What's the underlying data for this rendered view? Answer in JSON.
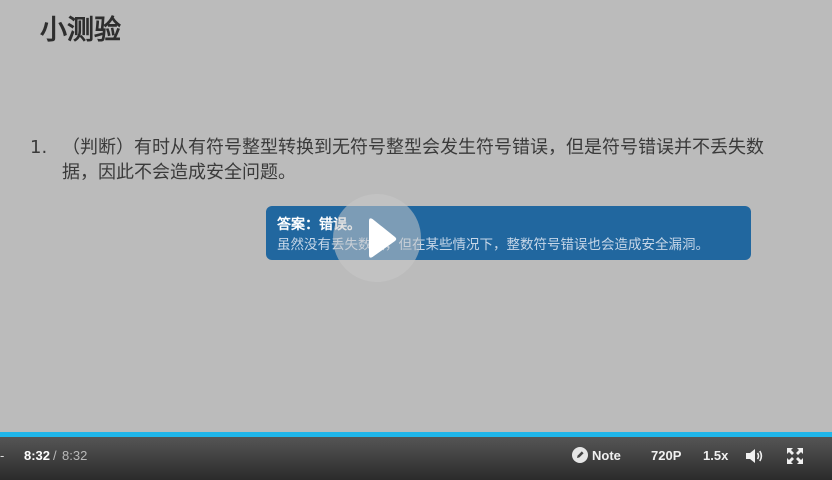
{
  "slide": {
    "title": "小测验",
    "question_number": "1.",
    "question_text": "（判断）有时从有符号整型转换到无符号整型会发生符号错误，但是符号错误并不丢失数据，因此不会造成安全问题。",
    "answer_title": "答案：错误。",
    "answer_body": "虽然没有丢失数据，但在某些情况下，整数符号错误也会造成安全漏洞。"
  },
  "player": {
    "progress_percent": 100,
    "accent_color": "#1fb6ea",
    "play_icon": "play-icon",
    "time_current": "8:32",
    "time_separator": "/",
    "time_total": "8:32",
    "note_label": "Note",
    "quality_label": "720P",
    "speed_label": "1.5x",
    "volume_icon": "volume-icon",
    "fullscreen_icon": "fullscreen-icon",
    "note_icon": "pencil-icon"
  }
}
